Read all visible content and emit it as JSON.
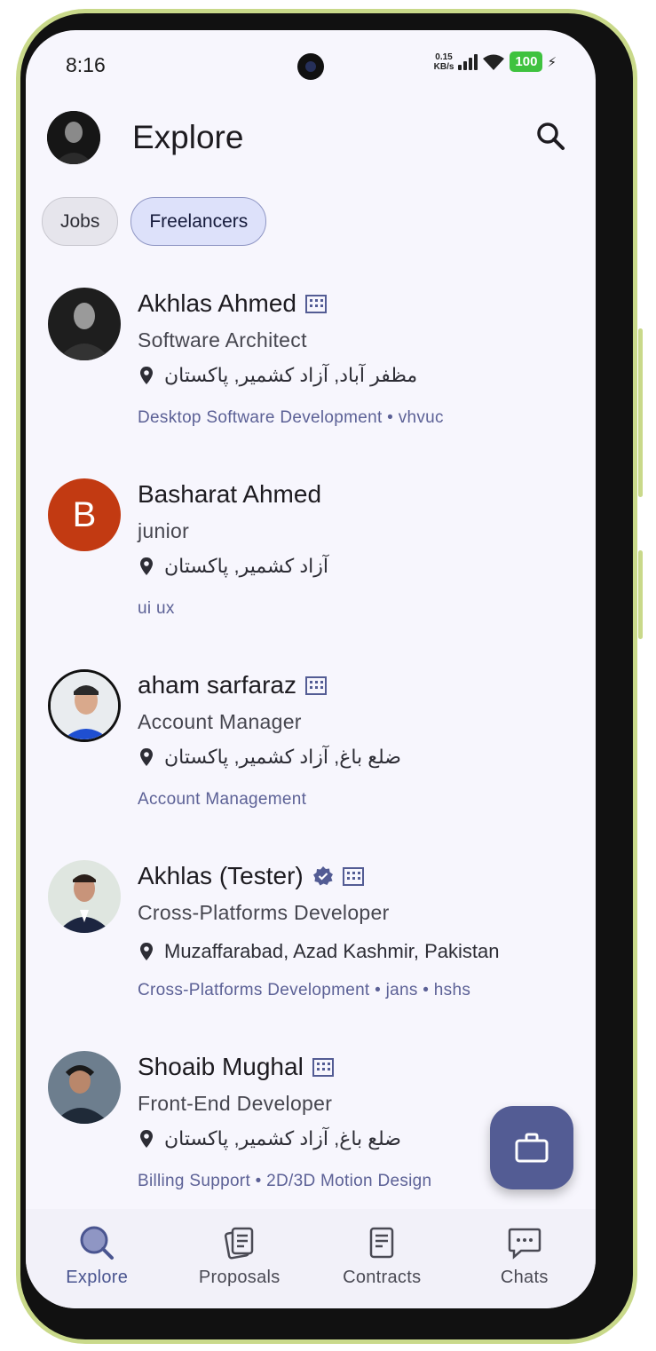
{
  "status_bar": {
    "time": "8:16",
    "net_speed_top": "0.15",
    "net_speed_bottom": "KB/s",
    "battery": "100"
  },
  "header": {
    "title": "Explore"
  },
  "chips": {
    "jobs": "Jobs",
    "freelancers": "Freelancers"
  },
  "freelancers": [
    {
      "name": "Akhlas Ahmed",
      "role": "Software Architect",
      "location": "مظفر آباد, آزاد کشمیر, پاکستان",
      "tags": "Desktop Software Development • vhvuc"
    },
    {
      "name": "Basharat Ahmed",
      "initial": "B",
      "role": "junior",
      "location": "آزاد کشمیر, پاکستان",
      "tags": "ui ux"
    },
    {
      "name": "aham sarfaraz",
      "role": "Account Manager",
      "location": "ضلع باغ, آزاد کشمیر, پاکستان",
      "tags": "Account Management"
    },
    {
      "name": "Akhlas (Tester)",
      "role": "Cross-Platforms Developer",
      "location": "Muzaffarabad, Azad Kashmir, Pakistan",
      "tags": "Cross-Platforms Development • jans • hshs"
    },
    {
      "name": "Shoaib Mughal",
      "role": "Front-End Developer",
      "location": "ضلع باغ, آزاد کشمیر, پاکستان",
      "tags": "Billing Support • 2D/3D Motion Design"
    }
  ],
  "bottom_nav": {
    "explore": "Explore",
    "proposals": "Proposals",
    "contracts": "Contracts",
    "chats": "Chats"
  },
  "colors": {
    "accent": "#535c94",
    "tag_text": "#5c6196",
    "initial_avatar_bg": "#c23a12"
  }
}
